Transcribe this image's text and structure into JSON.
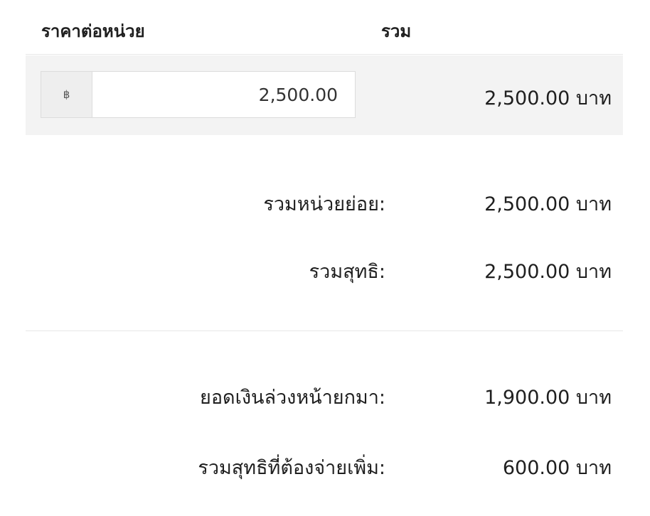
{
  "table": {
    "headers": {
      "unit_price": "ราคาต่อหน่วย",
      "total": "รวม"
    },
    "item": {
      "currency_symbol": "฿",
      "unit_price_value": "2,500.00",
      "line_total": "2,500.00 บาท"
    }
  },
  "summary": {
    "subtotal": {
      "label": "รวมหน่วยย่อย:",
      "value": "2,500.00 บาท"
    },
    "net_total": {
      "label": "รวมสุทธิ:",
      "value": "2,500.00 บาท"
    },
    "deposit_carried": {
      "label": "ยอดเงินล่วงหน้ายกมา:",
      "value": "1,900.00 บาท"
    },
    "net_due": {
      "label": "รวมสุทธิที่ต้องจ่ายเพิ่ม:",
      "value": "600.00 บาท"
    }
  }
}
